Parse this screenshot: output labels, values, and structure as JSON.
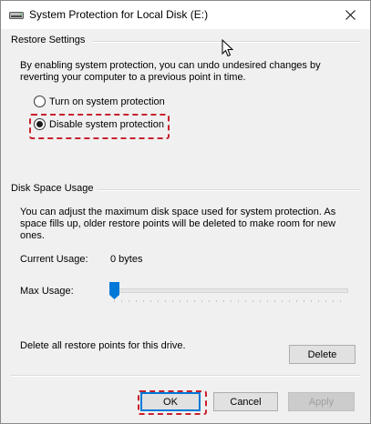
{
  "window": {
    "title": "System Protection for Local Disk (E:)",
    "icon": "drive-icon",
    "close_icon": "close-icon"
  },
  "restore_settings": {
    "group_label": "Restore Settings",
    "description": "By enabling system protection, you can undo undesired changes by reverting your computer to a previous point in time.",
    "options": [
      {
        "label": "Turn on system protection",
        "checked": false
      },
      {
        "label": "Disable system protection",
        "checked": true
      }
    ]
  },
  "disk_space": {
    "group_label": "Disk Space Usage",
    "description": "You can adjust the maximum disk space used for system protection. As space fills up, older restore points will be deleted to make room for new ones.",
    "current_usage_label": "Current Usage:",
    "current_usage_value": "0 bytes",
    "max_usage_label": "Max Usage:",
    "max_usage_level": 0,
    "delete_description": "Delete all restore points for this drive.",
    "delete_label": "Delete"
  },
  "buttons": {
    "ok": "OK",
    "cancel": "Cancel",
    "apply": "Apply"
  },
  "colors": {
    "highlight": "#c8202c",
    "slider_thumb": "#0078d7",
    "default_button_border": "#0078d7"
  }
}
